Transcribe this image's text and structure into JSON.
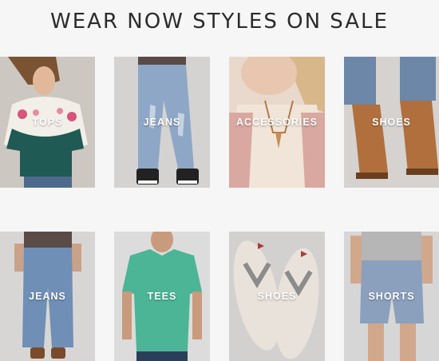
{
  "page": {
    "title": "WEAR NOW STYLES ON SALE"
  },
  "row1": [
    {
      "label": "TOPS"
    },
    {
      "label": "JEANS"
    },
    {
      "label": "ACCESSORIES"
    },
    {
      "label": "SHOES"
    }
  ],
  "row2": [
    {
      "label": "JEANS"
    },
    {
      "label": "TEES"
    },
    {
      "label": "SHOES"
    },
    {
      "label": "SHORTS"
    }
  ],
  "colors": {
    "background": "#f6f6f6",
    "title": "#2b2b2b",
    "label": "#ffffff"
  }
}
